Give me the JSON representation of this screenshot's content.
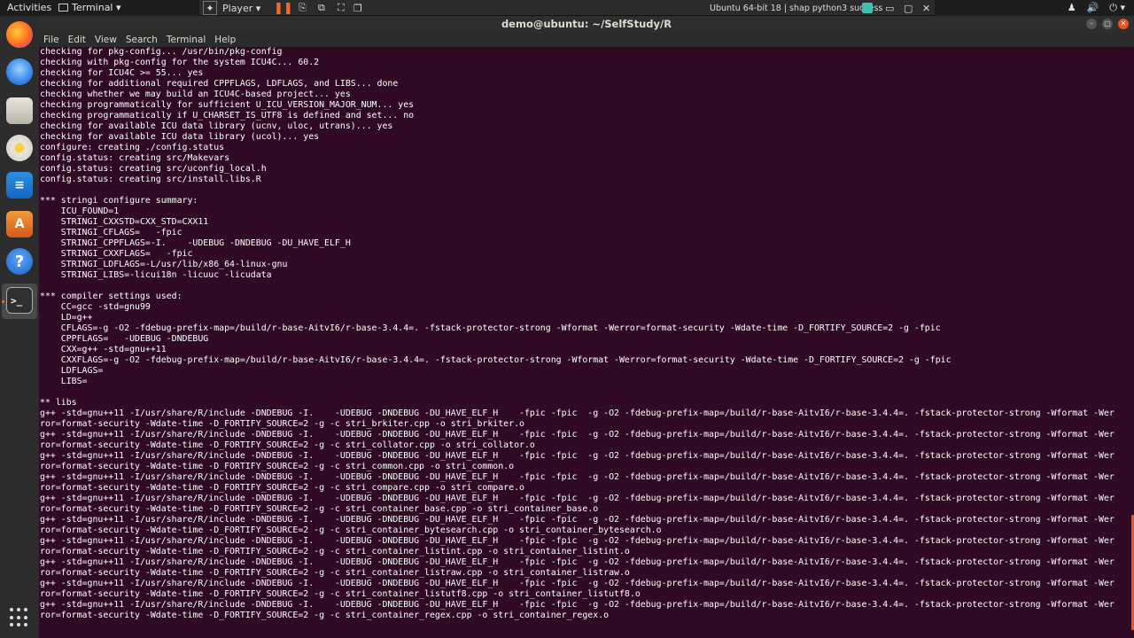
{
  "topbar": {
    "activities": "Activities",
    "app_menu": "Terminal ▾",
    "tray": [
      "♟",
      "🔊",
      "⏻ ▾"
    ]
  },
  "vmware": {
    "player_label": "Player ▾",
    "pause": "❚❚",
    "send_keys": "⎘",
    "snapshot": "⧉",
    "fullscreen": "⛶",
    "unity": "❐",
    "tab_name": "Ubuntu 64-bit 18 | shap python3 success",
    "min": "▭",
    "max": "▢",
    "close": "✕"
  },
  "window": {
    "title": "demo@ubuntu: ~/SelfStudy/R",
    "min": "–",
    "max": "▢",
    "close": "✕"
  },
  "menu": [
    "File",
    "Edit",
    "View",
    "Search",
    "Terminal",
    "Help"
  ],
  "dock": {
    "terminal_prompt": ">_",
    "help": "?",
    "writer": "≡",
    "software": "A"
  },
  "terminal_lines": [
    "checking for pkg-config... /usr/bin/pkg-config",
    "checking with pkg-config for the system ICU4C... 60.2",
    "checking for ICU4C >= 55... yes",
    "checking for additional required CPPFLAGS, LDFLAGS, and LIBS... done",
    "checking whether we may build an ICU4C-based project... yes",
    "checking programmatically for sufficient U_ICU_VERSION_MAJOR_NUM... yes",
    "checking programmatically if U_CHARSET_IS_UTF8 is defined and set... no",
    "checking for available ICU data library (ucnv, uloc, utrans)... yes",
    "checking for available ICU data library (ucol)... yes",
    "configure: creating ./config.status",
    "config.status: creating src/Makevars",
    "config.status: creating src/uconfig_local.h",
    "config.status: creating src/install.libs.R",
    "",
    "*** stringi configure summary:",
    "    ICU_FOUND=1",
    "    STRINGI_CXXSTD=CXX_STD=CXX11",
    "    STRINGI_CFLAGS=   -fpic",
    "    STRINGI_CPPFLAGS=-I.    -UDEBUG -DNDEBUG -DU_HAVE_ELF_H",
    "    STRINGI_CXXFLAGS=   -fpic",
    "    STRINGI_LDFLAGS=-L/usr/lib/x86_64-linux-gnu",
    "    STRINGI_LIBS=-licui18n -licuuc -licudata",
    "",
    "*** compiler settings used:",
    "    CC=gcc -std=gnu99",
    "    LD=g++",
    "    CFLAGS=-g -O2 -fdebug-prefix-map=/build/r-base-AitvI6/r-base-3.4.4=. -fstack-protector-strong -Wformat -Werror=format-security -Wdate-time -D_FORTIFY_SOURCE=2 -g -fpic",
    "    CPPFLAGS=   -UDEBUG -DNDEBUG",
    "    CXX=g++ -std=gnu++11",
    "    CXXFLAGS=-g -O2 -fdebug-prefix-map=/build/r-base-AitvI6/r-base-3.4.4=. -fstack-protector-strong -Wformat -Werror=format-security -Wdate-time -D_FORTIFY_SOURCE=2 -g -fpic",
    "    LDFLAGS=",
    "    LIBS=",
    "",
    "** libs",
    "g++ -std=gnu++11 -I/usr/share/R/include -DNDEBUG -I.    -UDEBUG -DNDEBUG -DU_HAVE_ELF_H    -fpic -fpic  -g -O2 -fdebug-prefix-map=/build/r-base-AitvI6/r-base-3.4.4=. -fstack-protector-strong -Wformat -Wer",
    "ror=format-security -Wdate-time -D_FORTIFY_SOURCE=2 -g -c stri_brkiter.cpp -o stri_brkiter.o",
    "g++ -std=gnu++11 -I/usr/share/R/include -DNDEBUG -I.    -UDEBUG -DNDEBUG -DU_HAVE_ELF_H    -fpic -fpic  -g -O2 -fdebug-prefix-map=/build/r-base-AitvI6/r-base-3.4.4=. -fstack-protector-strong -Wformat -Wer",
    "ror=format-security -Wdate-time -D_FORTIFY_SOURCE=2 -g -c stri_collator.cpp -o stri_collator.o",
    "g++ -std=gnu++11 -I/usr/share/R/include -DNDEBUG -I.    -UDEBUG -DNDEBUG -DU_HAVE_ELF_H    -fpic -fpic  -g -O2 -fdebug-prefix-map=/build/r-base-AitvI6/r-base-3.4.4=. -fstack-protector-strong -Wformat -Wer",
    "ror=format-security -Wdate-time -D_FORTIFY_SOURCE=2 -g -c stri_common.cpp -o stri_common.o",
    "g++ -std=gnu++11 -I/usr/share/R/include -DNDEBUG -I.    -UDEBUG -DNDEBUG -DU_HAVE_ELF_H    -fpic -fpic  -g -O2 -fdebug-prefix-map=/build/r-base-AitvI6/r-base-3.4.4=. -fstack-protector-strong -Wformat -Wer",
    "ror=format-security -Wdate-time -D_FORTIFY_SOURCE=2 -g -c stri_compare.cpp -o stri_compare.o",
    "g++ -std=gnu++11 -I/usr/share/R/include -DNDEBUG -I.    -UDEBUG -DNDEBUG -DU_HAVE_ELF_H    -fpic -fpic  -g -O2 -fdebug-prefix-map=/build/r-base-AitvI6/r-base-3.4.4=. -fstack-protector-strong -Wformat -Wer",
    "ror=format-security -Wdate-time -D_FORTIFY_SOURCE=2 -g -c stri_container_base.cpp -o stri_container_base.o",
    "g++ -std=gnu++11 -I/usr/share/R/include -DNDEBUG -I.    -UDEBUG -DNDEBUG -DU_HAVE_ELF_H    -fpic -fpic  -g -O2 -fdebug-prefix-map=/build/r-base-AitvI6/r-base-3.4.4=. -fstack-protector-strong -Wformat -Wer",
    "ror=format-security -Wdate-time -D_FORTIFY_SOURCE=2 -g -c stri_container_bytesearch.cpp -o stri_container_bytesearch.o",
    "g++ -std=gnu++11 -I/usr/share/R/include -DNDEBUG -I.    -UDEBUG -DNDEBUG -DU_HAVE_ELF_H    -fpic -fpic  -g -O2 -fdebug-prefix-map=/build/r-base-AitvI6/r-base-3.4.4=. -fstack-protector-strong -Wformat -Wer",
    "ror=format-security -Wdate-time -D_FORTIFY_SOURCE=2 -g -c stri_container_listint.cpp -o stri_container_listint.o",
    "g++ -std=gnu++11 -I/usr/share/R/include -DNDEBUG -I.    -UDEBUG -DNDEBUG -DU_HAVE_ELF_H    -fpic -fpic  -g -O2 -fdebug-prefix-map=/build/r-base-AitvI6/r-base-3.4.4=. -fstack-protector-strong -Wformat -Wer",
    "ror=format-security -Wdate-time -D_FORTIFY_SOURCE=2 -g -c stri_container_listraw.cpp -o stri_container_listraw.o",
    "g++ -std=gnu++11 -I/usr/share/R/include -DNDEBUG -I.    -UDEBUG -DNDEBUG -DU_HAVE_ELF_H    -fpic -fpic  -g -O2 -fdebug-prefix-map=/build/r-base-AitvI6/r-base-3.4.4=. -fstack-protector-strong -Wformat -Wer",
    "ror=format-security -Wdate-time -D_FORTIFY_SOURCE=2 -g -c stri_container_listutf8.cpp -o stri_container_listutf8.o",
    "g++ -std=gnu++11 -I/usr/share/R/include -DNDEBUG -I.    -UDEBUG -DNDEBUG -DU_HAVE_ELF_H    -fpic -fpic  -g -O2 -fdebug-prefix-map=/build/r-base-AitvI6/r-base-3.4.4=. -fstack-protector-strong -Wformat -Wer",
    "ror=format-security -Wdate-time -D_FORTIFY_SOURCE=2 -g -c stri_container_regex.cpp -o stri_container_regex.o"
  ],
  "colors": {
    "terminal_bg": "#300a24",
    "terminal_fg": "#ffffff",
    "accent": "#e95420"
  }
}
